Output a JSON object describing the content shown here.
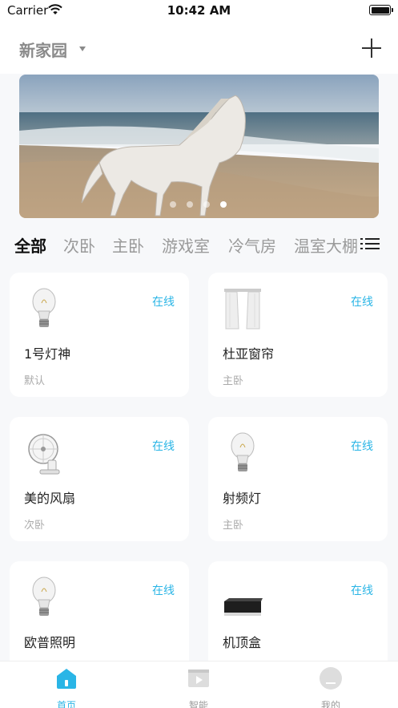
{
  "status_bar": {
    "carrier": "Carrier",
    "time": "10:42 AM"
  },
  "header": {
    "home_name": "新家园"
  },
  "banner": {
    "slide_count": 4,
    "active_slide": 4
  },
  "room_tabs": [
    {
      "label": "全部",
      "active": true
    },
    {
      "label": "次卧",
      "active": false
    },
    {
      "label": "主卧",
      "active": false
    },
    {
      "label": "游戏室",
      "active": false
    },
    {
      "label": "冷气房",
      "active": false
    },
    {
      "label": "温室大棚",
      "active": false
    }
  ],
  "devices": [
    {
      "name": "1号灯神",
      "room": "默认",
      "status": "在线",
      "icon": "bulb-icon"
    },
    {
      "name": "杜亚窗帘",
      "room": "主卧",
      "status": "在线",
      "icon": "curtain-icon"
    },
    {
      "name": "美的风扇",
      "room": "次卧",
      "status": "在线",
      "icon": "fan-icon"
    },
    {
      "name": "射频灯",
      "room": "主卧",
      "status": "在线",
      "icon": "bulb-icon"
    },
    {
      "name": "欧普照明",
      "room": "",
      "status": "在线",
      "icon": "bulb-icon"
    },
    {
      "name": "机顶盒",
      "room": "",
      "status": "在线",
      "icon": "settop-box-icon"
    }
  ],
  "tab_bar": [
    {
      "label": "首页",
      "icon": "home-icon",
      "active": true
    },
    {
      "label": "智能",
      "icon": "smart-icon",
      "active": false
    },
    {
      "label": "我的",
      "icon": "profile-icon",
      "active": false
    }
  ],
  "colors": {
    "accent": "#2ab5e6",
    "inactive": "#999999",
    "background": "#f7f8fa"
  }
}
